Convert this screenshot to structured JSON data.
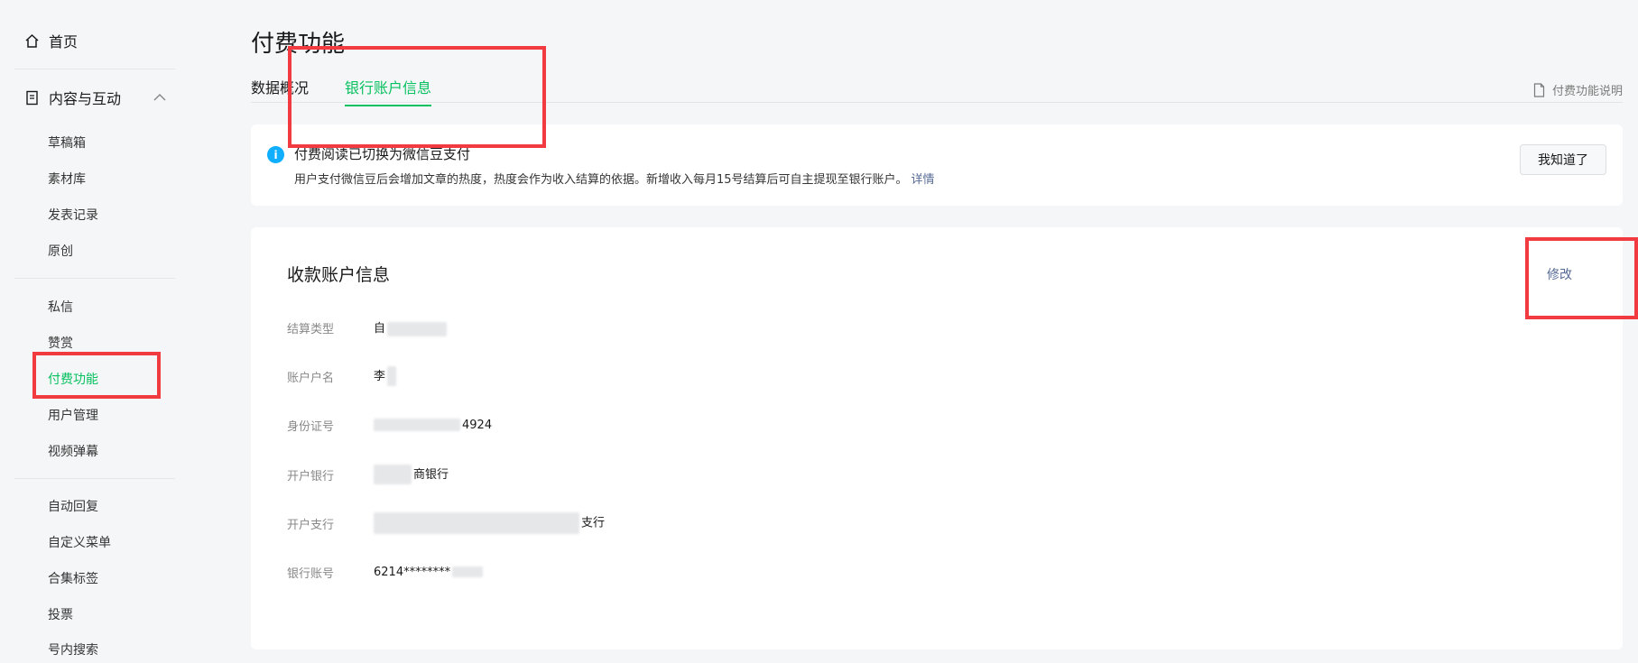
{
  "sidebar": {
    "home": "首页",
    "group_content": "内容与互动",
    "items_a": [
      "草稿箱",
      "素材库",
      "发表记录",
      "原创"
    ],
    "items_b": [
      "私信",
      "赞赏",
      "付费功能",
      "用户管理",
      "视频弹幕"
    ],
    "items_c": [
      "自动回复",
      "自定义菜单",
      "合集标签",
      "投票",
      "号内搜索"
    ],
    "active_item": "付费功能"
  },
  "page": {
    "title": "付费功能",
    "tabs": [
      "数据概况",
      "银行账户信息"
    ],
    "active_tab": "银行账户信息",
    "help_link": "付费功能说明"
  },
  "notice": {
    "title": "付费阅读已切换为微信豆支付",
    "desc": "用户支付微信豆后会增加文章的热度，热度会作为收入结算的依据。新增收入每月15号结算后可自主提现至银行账户。",
    "detail_link": "详情",
    "ack_button": "我知道了"
  },
  "account": {
    "title": "收款账户信息",
    "edit": "修改",
    "fields": [
      {
        "label": "结算类型",
        "value": "自"
      },
      {
        "label": "账户户名",
        "value": "李"
      },
      {
        "label": "身份证号",
        "value": "4924"
      },
      {
        "label": "开户银行",
        "value": "商银行"
      },
      {
        "label": "开户支行",
        "value": "支行"
      },
      {
        "label": "银行账号",
        "value": "6214********"
      }
    ]
  },
  "colors": {
    "accent": "#07c160",
    "link": "#576b95",
    "highlight": "#f23b40",
    "info": "#10aeff"
  }
}
